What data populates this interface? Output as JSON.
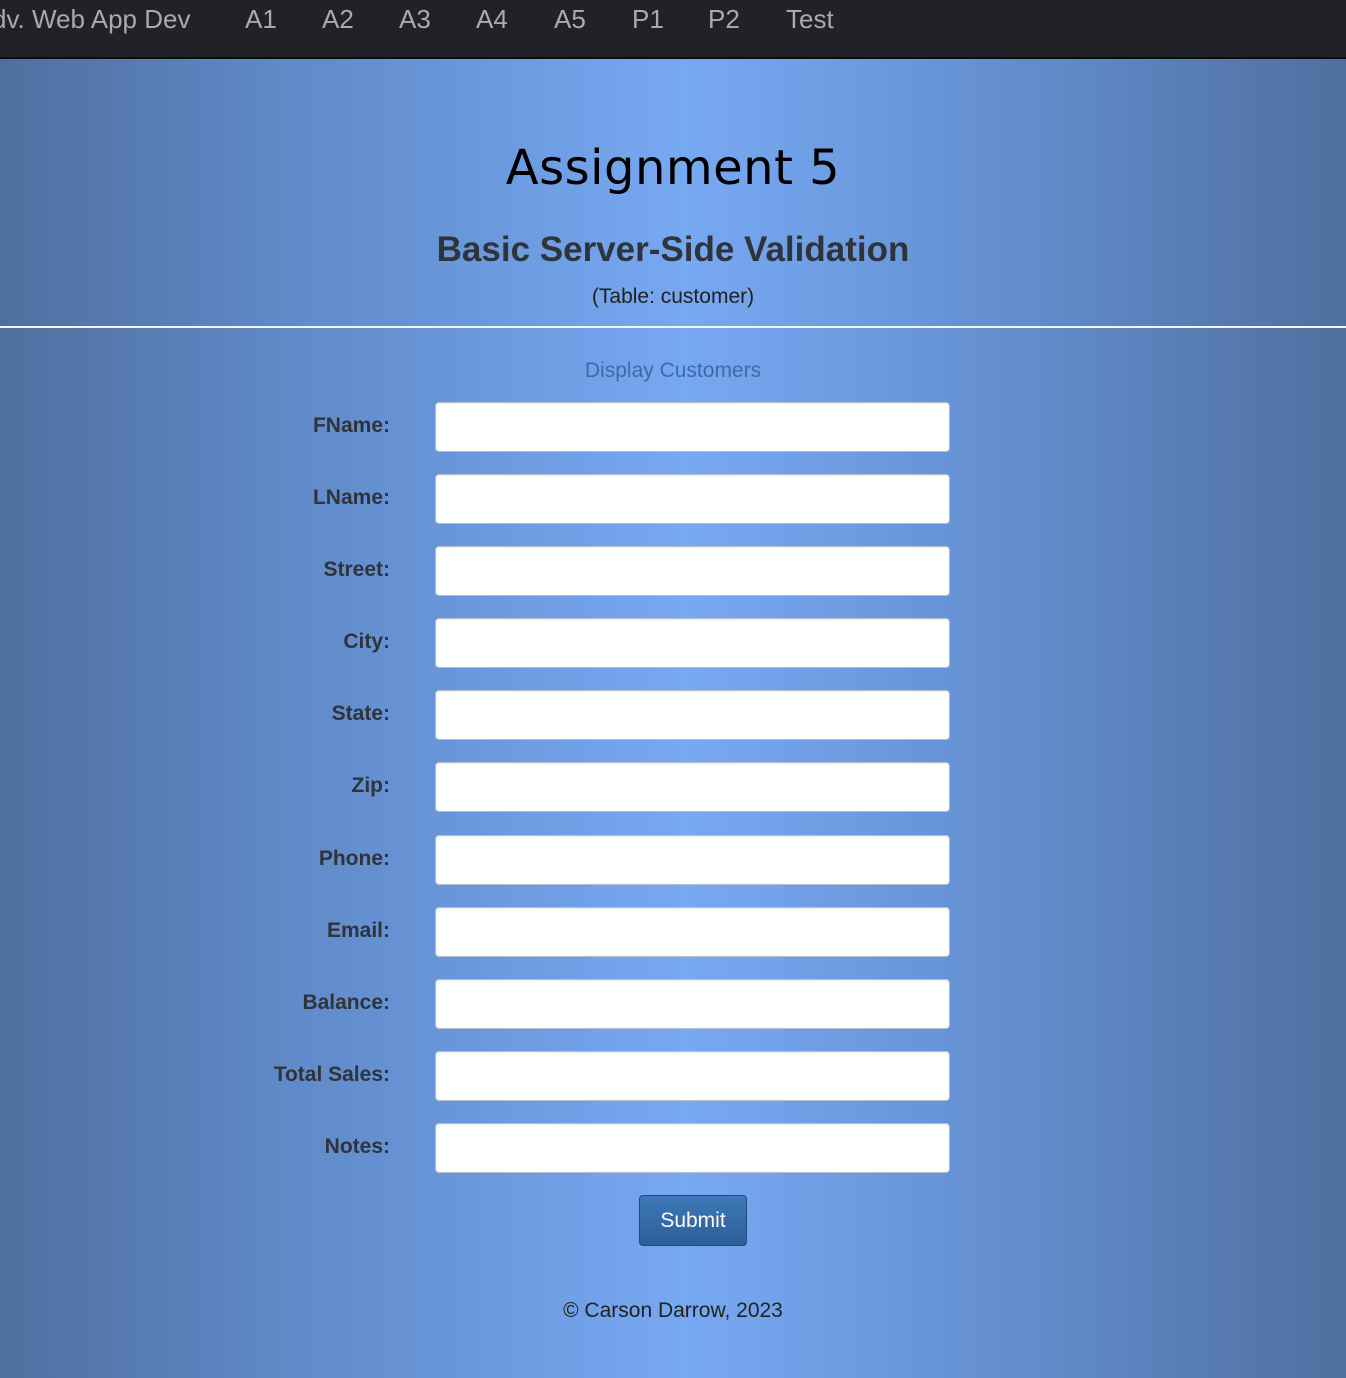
{
  "nav": {
    "brand": "dv. Web App Dev",
    "links": [
      "A1",
      "A2",
      "A3",
      "A4",
      "A5",
      "P1",
      "P2",
      "Test"
    ]
  },
  "header": {
    "title": "Assignment 5",
    "subtitle": "Basic Server-Side Validation",
    "table_note": "(Table: customer)"
  },
  "main": {
    "display_link": "Display Customers",
    "fields": [
      {
        "label": "FName:",
        "value": ""
      },
      {
        "label": "LName:",
        "value": ""
      },
      {
        "label": "Street:",
        "value": ""
      },
      {
        "label": "City:",
        "value": ""
      },
      {
        "label": "State:",
        "value": ""
      },
      {
        "label": "Zip:",
        "value": ""
      },
      {
        "label": "Phone:",
        "value": ""
      },
      {
        "label": "Email:",
        "value": ""
      },
      {
        "label": "Balance:",
        "value": ""
      },
      {
        "label": "Total Sales:",
        "value": ""
      },
      {
        "label": "Notes:",
        "value": ""
      }
    ],
    "submit_label": "Submit"
  },
  "footer": {
    "text": "© Carson Darrow, 2023"
  }
}
